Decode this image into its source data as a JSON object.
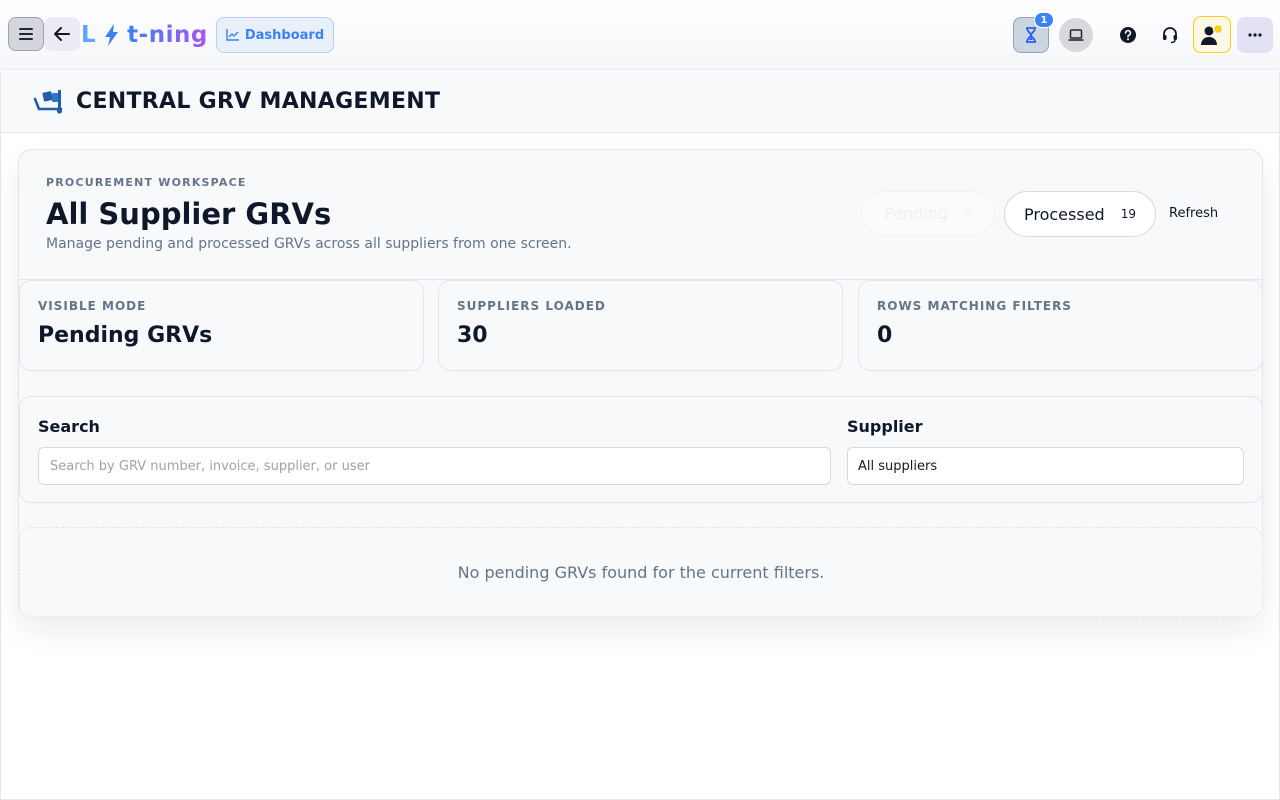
{
  "topbar": {
    "logo_left": "L",
    "logo_right": "t-ning",
    "dashboard_label": "Dashboard",
    "pending_badge": "1"
  },
  "icons": {
    "menu": "hamburger-icon",
    "back": "arrow-left-icon",
    "logo": "lightning-bolt-icon",
    "dashboard": "chart-line-icon",
    "pending": "hourglass-icon",
    "laptop": "laptop-icon",
    "help": "question-circle-icon",
    "support": "headset-icon",
    "user": "user-status-icon",
    "more": "ellipsis-icon",
    "page": "truck-loading-icon"
  },
  "colors": {
    "accent": "#3b82f6",
    "brand_gradient_end": "#a855f7",
    "user_status": "#facc15"
  },
  "page": {
    "title": "CENTRAL GRV MANAGEMENT"
  },
  "workspace": {
    "eyebrow": "PROCUREMENT WORKSPACE",
    "title": "All Supplier GRVs",
    "subtitle": "Manage pending and processed GRVs across all suppliers from one screen.",
    "tabs": [
      {
        "label": "Pending",
        "count": "0"
      },
      {
        "label": "Processed",
        "count": "19"
      }
    ],
    "refresh_label": "Refresh"
  },
  "stats": [
    {
      "label": "VISIBLE MODE",
      "value": "Pending GRVs"
    },
    {
      "label": "SUPPLIERS LOADED",
      "value": "30"
    },
    {
      "label": "ROWS MATCHING FILTERS",
      "value": "0"
    }
  ],
  "filters": {
    "search_label": "Search",
    "search_value": "",
    "search_placeholder": "Search by GRV number, invoice, supplier, or user",
    "supplier_label": "Supplier",
    "supplier_value": "All suppliers"
  },
  "empty_state": "No pending GRVs found for the current filters."
}
